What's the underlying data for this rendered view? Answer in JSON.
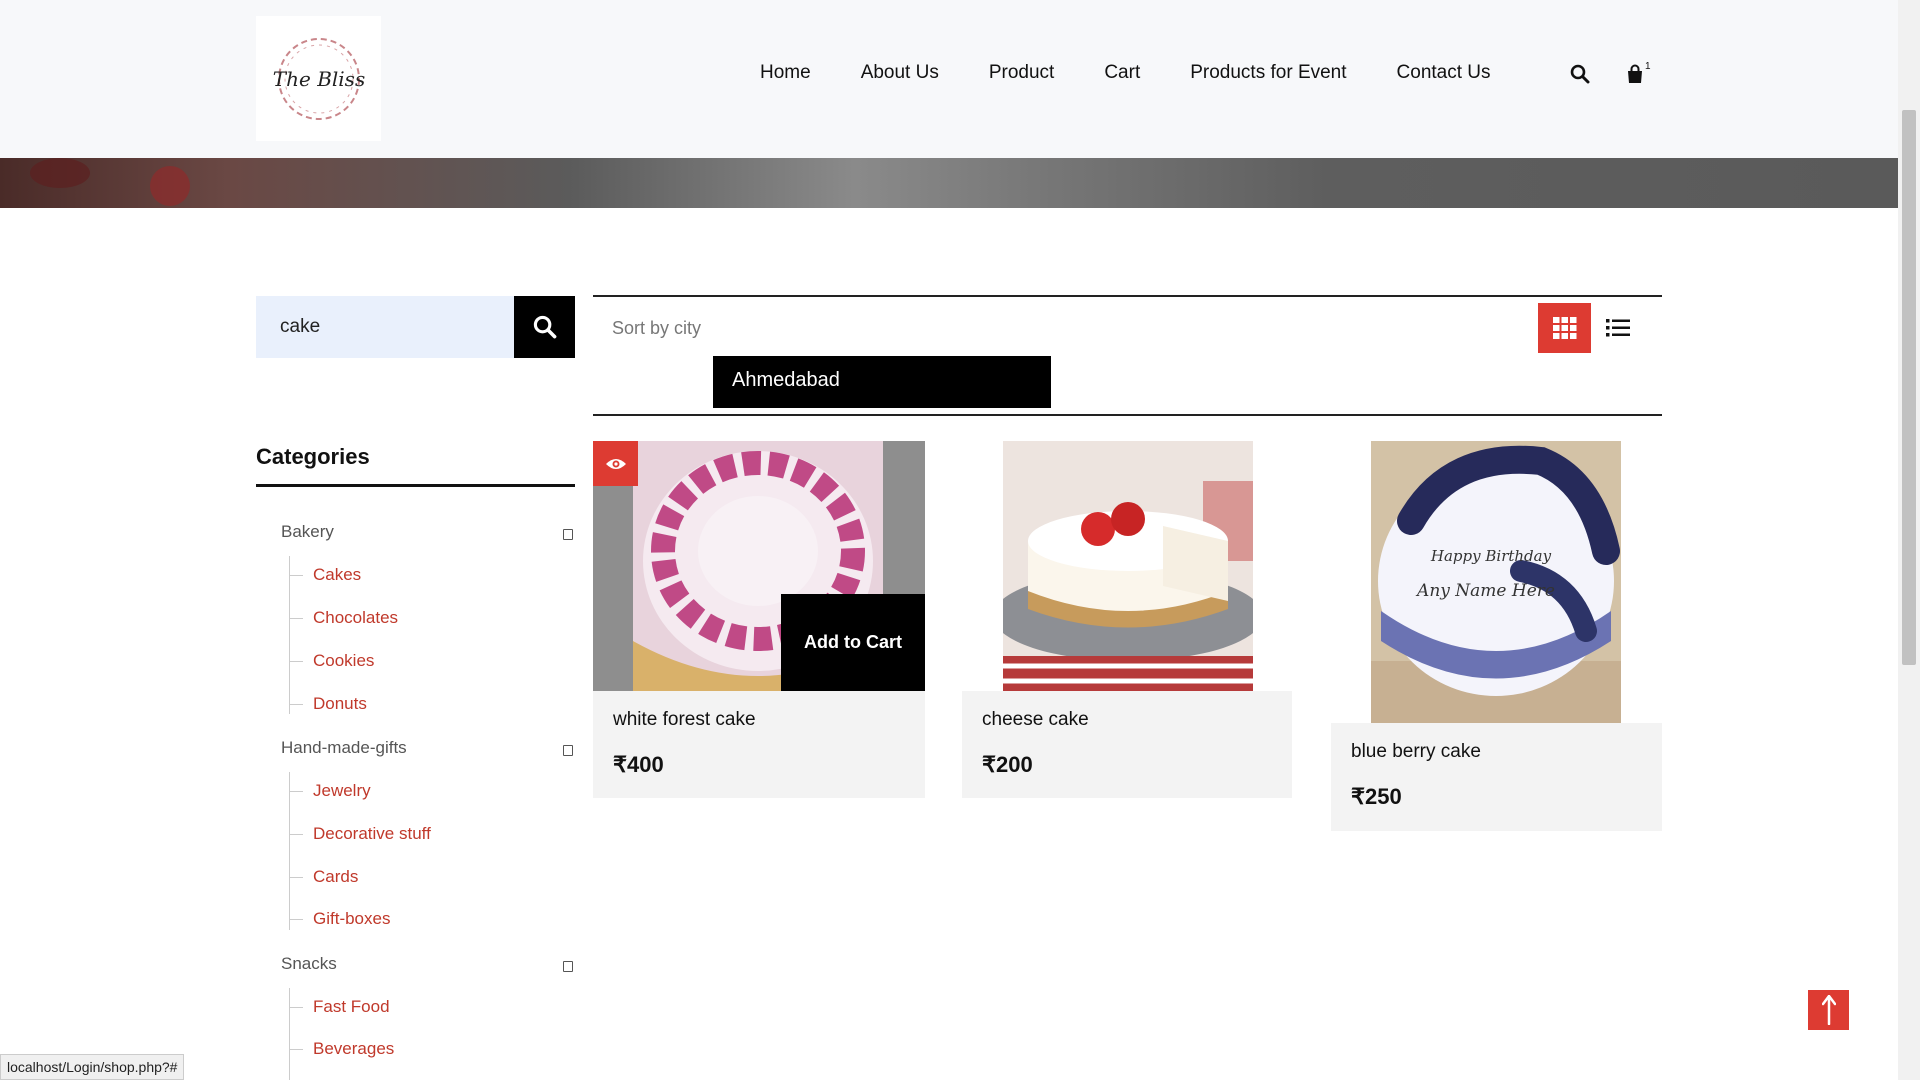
{
  "brand": {
    "logo_text": "The Bliss"
  },
  "nav": {
    "items": [
      "Home",
      "About Us",
      "Product",
      "Cart",
      "Products for Event",
      "Contact Us"
    ],
    "cart_count": "1"
  },
  "search": {
    "value": "cake"
  },
  "categories": {
    "title": "Categories",
    "groups": [
      {
        "label": "Bakery",
        "children": [
          "Cakes",
          "Chocolates",
          "Cookies",
          "Donuts"
        ]
      },
      {
        "label": "Hand-made-gifts",
        "children": [
          "Jewelry",
          "Decorative stuff",
          "Cards",
          "Gift-boxes"
        ]
      },
      {
        "label": "Snacks",
        "children": [
          "Fast Food",
          "Beverages"
        ]
      }
    ]
  },
  "toolbar": {
    "sort_label": "Sort by city",
    "city": "Ahmedabad"
  },
  "products": [
    {
      "name": "white forest cake",
      "price": "₹400",
      "add_to_cart": "Add to Cart"
    },
    {
      "name": "cheese cake",
      "price": "₹200"
    },
    {
      "name": "blue berry cake",
      "price": "₹250",
      "image_text_1": "Happy Birthday",
      "image_text_2": "Any Name Here"
    }
  ],
  "status_bar": {
    "url": "localhost/Login/shop.php?#"
  },
  "colors": {
    "accent": "#dd3b32",
    "link": "#c0392b",
    "dark": "#000000"
  }
}
